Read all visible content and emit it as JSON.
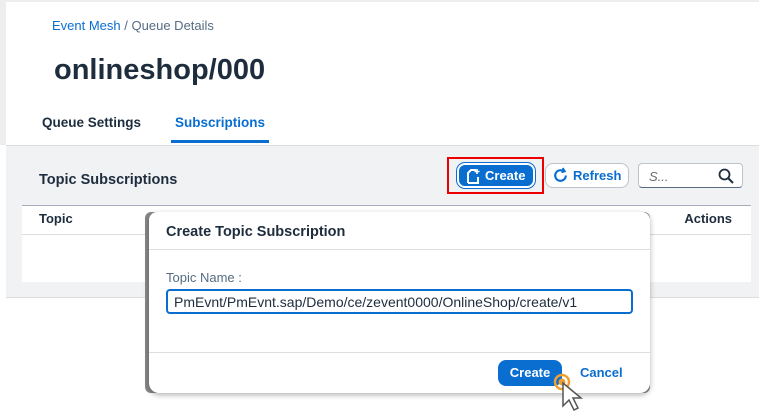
{
  "breadcrumb": {
    "items": [
      "Event Mesh"
    ],
    "separator": "/",
    "current": "Queue Details"
  },
  "page_title": "onlineshop/000",
  "tabs": [
    {
      "label": "Queue Settings",
      "active": false
    },
    {
      "label": "Subscriptions",
      "active": true
    }
  ],
  "section": {
    "title": "Topic Subscriptions",
    "create_label": "Create",
    "refresh_label": "Refresh",
    "search_placeholder": "S..."
  },
  "table": {
    "columns": [
      "Topic",
      "Actions"
    ]
  },
  "dialog": {
    "title": "Create Topic Subscription",
    "field_label": "Topic Name :",
    "field_value": "PmEvnt/PmEvnt.sap/Demo/ce/zevent0000/OnlineShop/create/v1",
    "create_label": "Create",
    "cancel_label": "Cancel"
  },
  "colors": {
    "accent": "#0a6ed1",
    "highlight": "#e00000"
  }
}
